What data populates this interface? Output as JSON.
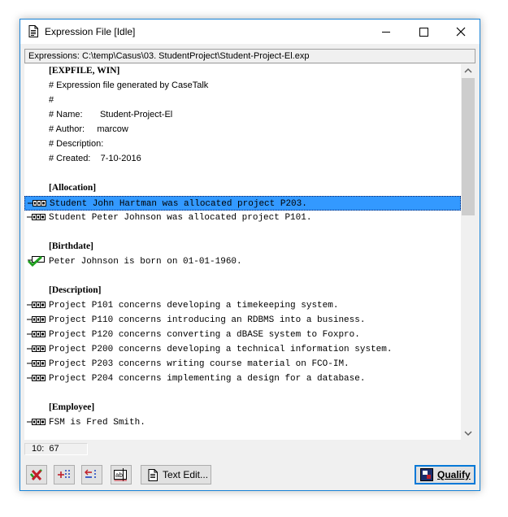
{
  "window": {
    "title": "Expression File [Idle]",
    "colors": {
      "border": "#1883d7",
      "selection": "#3399ff",
      "check": "#20a020",
      "delete": "#c0202a",
      "accent": "#0078d7"
    }
  },
  "path": "Expressions: C:\\temp\\Casus\\03. StudentProject\\Student-Project-El.exp",
  "editor": {
    "lines": [
      {
        "kind": "section",
        "text": "[EXPFILE, WIN]"
      },
      {
        "kind": "comment",
        "text": "# Expression file generated by CaseTalk"
      },
      {
        "kind": "comment",
        "text": "#"
      },
      {
        "kind": "comment",
        "text": "# Name:       Student-Project-El"
      },
      {
        "kind": "comment",
        "text": "# Author:     marcow"
      },
      {
        "kind": "comment",
        "text": "# Description:"
      },
      {
        "kind": "comment",
        "text": "# Created:    7-10-2016"
      },
      {
        "kind": "blank",
        "text": ""
      },
      {
        "kind": "section",
        "text": "[Allocation]"
      },
      {
        "kind": "fact",
        "icon": "fact-icon",
        "selected": true,
        "text": "Student John Hartman was allocated project P203."
      },
      {
        "kind": "fact",
        "icon": "fact-icon",
        "text": "Student Peter Johnson was allocated project P101."
      },
      {
        "kind": "blank",
        "text": ""
      },
      {
        "kind": "section",
        "text": "[Birthdate]"
      },
      {
        "kind": "fact",
        "icon": "qualified-fact-icon",
        "text": "Peter Johnson is born on 01-01-1960."
      },
      {
        "kind": "blank",
        "text": ""
      },
      {
        "kind": "section",
        "text": "[Description]"
      },
      {
        "kind": "fact",
        "icon": "fact-icon",
        "text": "Project P101 concerns developing a timekeeping system."
      },
      {
        "kind": "fact",
        "icon": "fact-icon",
        "text": "Project P110 concerns introducing an RDBMS into a business."
      },
      {
        "kind": "fact",
        "icon": "fact-icon",
        "text": "Project P120 concerns converting a dBASE system to Foxpro."
      },
      {
        "kind": "fact",
        "icon": "fact-icon",
        "text": "Project P200 concerns developing a technical information system."
      },
      {
        "kind": "fact",
        "icon": "fact-icon",
        "text": "Project P203 concerns writing course material on FCO-IM."
      },
      {
        "kind": "fact",
        "icon": "fact-icon",
        "text": "Project P204 concerns implementing a design for a database."
      },
      {
        "kind": "blank",
        "text": ""
      },
      {
        "kind": "section",
        "text": "[Employee]"
      },
      {
        "kind": "fact",
        "icon": "fact-icon",
        "text": "FSM is Fred Smith."
      }
    ]
  },
  "status": {
    "position": "10:  67"
  },
  "toolbar": {
    "delete_icon": "delete-x-icon",
    "add_icon": "add-line-icon",
    "remove_icon": "remove-line-icon",
    "rename_icon": "rename-ab-icon",
    "text_edit_label": "Text Edit...",
    "qualify_label": "Qualify"
  }
}
